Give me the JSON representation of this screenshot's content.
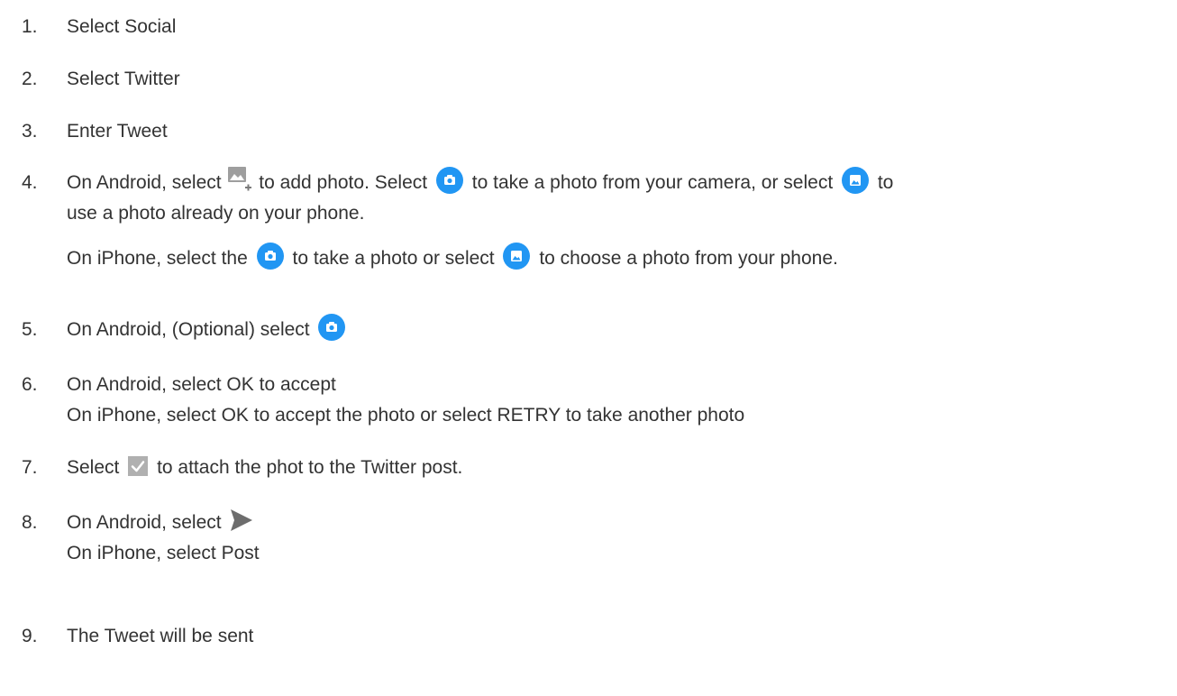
{
  "steps": [
    {
      "num": "1.",
      "text": "Select Social"
    },
    {
      "num": "2.",
      "text": "Select Twitter"
    },
    {
      "num": "3.",
      "text": "Enter Tweet"
    },
    {
      "num": "4.",
      "android_a": "On Android, select",
      "android_b": "to add photo. Select",
      "android_c": "to take a photo from your camera, or select",
      "android_d": "to",
      "android_e": "use a photo already on your phone.",
      "iphone_a": "On iPhone, select the",
      "iphone_b": "to take a photo or select",
      "iphone_c": "to choose a photo from your phone."
    },
    {
      "num": "5.",
      "text": "On Android, (Optional) select"
    },
    {
      "num": "6.",
      "line1": "On Android, select OK to accept",
      "line2": "On iPhone, select OK to accept the photo or select RETRY to take another photo"
    },
    {
      "num": "7.",
      "text_a": "Select",
      "text_b": "to attach the phot to the Twitter post."
    },
    {
      "num": "8.",
      "line1": "On Android, select",
      "line2": "On iPhone, select Post"
    },
    {
      "num": "9.",
      "text": "The Tweet will be sent"
    }
  ],
  "colors": {
    "text": "#333333",
    "icon_blue": "#2196f3",
    "icon_grey": "#9e9e9e",
    "check_grey": "#b0b0b0",
    "send_grey": "#6d6d6d"
  },
  "icons": {
    "add_photo": "add-photo-icon",
    "camera": "camera-icon",
    "gallery": "gallery-icon",
    "check": "check-icon",
    "send": "send-icon"
  }
}
